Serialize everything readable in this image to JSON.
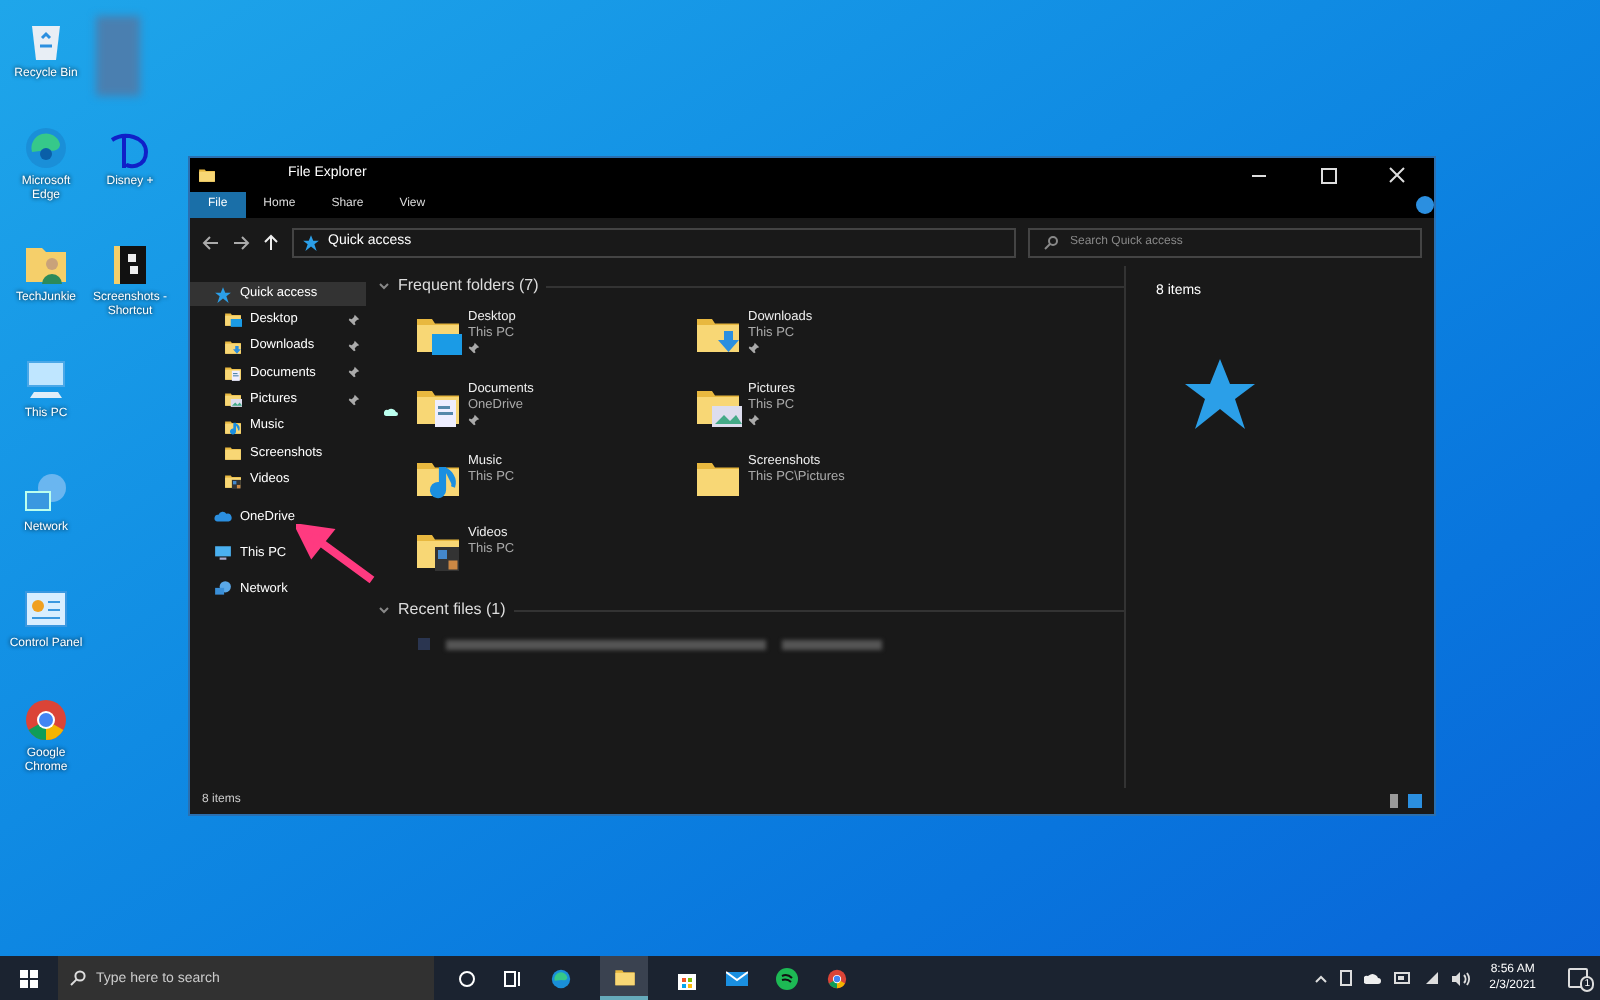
{
  "desktop_icons": [
    {
      "label": "Recycle Bin",
      "kind": "recycle"
    },
    {
      "label": "Microsoft Edge",
      "kind": "edge"
    },
    {
      "label": "Disney +",
      "kind": "disney"
    },
    {
      "label": "TechJunkie",
      "kind": "userfolder"
    },
    {
      "label": "Screenshots - Shortcut",
      "kind": "shortcutfolder"
    },
    {
      "label": "This PC",
      "kind": "pc"
    },
    {
      "label": "Network",
      "kind": "network"
    },
    {
      "label": "Control Panel",
      "kind": "control"
    },
    {
      "label": "Google Chrome",
      "kind": "chrome"
    }
  ],
  "window": {
    "title": "File Explorer",
    "ribbon_tabs": [
      {
        "label": "File",
        "selected": true
      },
      {
        "label": "Home",
        "selected": false
      },
      {
        "label": "Share",
        "selected": false
      },
      {
        "label": "View",
        "selected": false
      }
    ],
    "address": "Quick access",
    "search": {
      "placeholder": "Search Quick access"
    },
    "nav": [
      {
        "label": "Quick access",
        "kind": "quick",
        "selected": true,
        "children": [
          {
            "label": "Desktop",
            "kind": "desktop",
            "pinned": true
          },
          {
            "label": "Downloads",
            "kind": "downloads",
            "pinned": true
          },
          {
            "label": "Documents",
            "kind": "documents",
            "pinned": true
          },
          {
            "label": "Pictures",
            "kind": "pictures",
            "pinned": true
          },
          {
            "label": "Music",
            "kind": "music",
            "pinned": false
          },
          {
            "label": "Screenshots",
            "kind": "folder",
            "pinned": false
          },
          {
            "label": "Videos",
            "kind": "videos",
            "pinned": false
          }
        ]
      },
      {
        "label": "OneDrive",
        "kind": "onedrive",
        "selected": false
      },
      {
        "label": "This PC",
        "kind": "pc",
        "selected": false
      },
      {
        "label": "Network",
        "kind": "network",
        "selected": false
      }
    ],
    "frequent": {
      "heading": "Frequent folders (7)",
      "folders": [
        {
          "name": "Desktop",
          "location": "This PC",
          "kind": "desktop",
          "pinned": true,
          "cloud": false
        },
        {
          "name": "Downloads",
          "location": "This PC",
          "kind": "downloads",
          "pinned": true,
          "cloud": false
        },
        {
          "name": "Documents",
          "location": "OneDrive",
          "kind": "documents",
          "pinned": true,
          "cloud": true
        },
        {
          "name": "Pictures",
          "location": "This PC",
          "kind": "pictures",
          "pinned": true,
          "cloud": false
        },
        {
          "name": "Music",
          "location": "This PC",
          "kind": "music",
          "pinned": false,
          "cloud": false
        },
        {
          "name": "Screenshots",
          "location": "This PC\\Pictures",
          "kind": "folder",
          "pinned": false,
          "cloud": false
        },
        {
          "name": "Videos",
          "location": "This PC",
          "kind": "videos",
          "pinned": false,
          "cloud": false
        }
      ]
    },
    "recent": {
      "heading": "Recent files (1)"
    },
    "details": {
      "count": "8 items"
    },
    "status_bar": {
      "count": "8 items"
    }
  },
  "taskbar": {
    "search": {
      "placeholder": "Type here to search"
    },
    "time": "8:56 AM",
    "date": "2/3/2021",
    "notifications": "1"
  }
}
